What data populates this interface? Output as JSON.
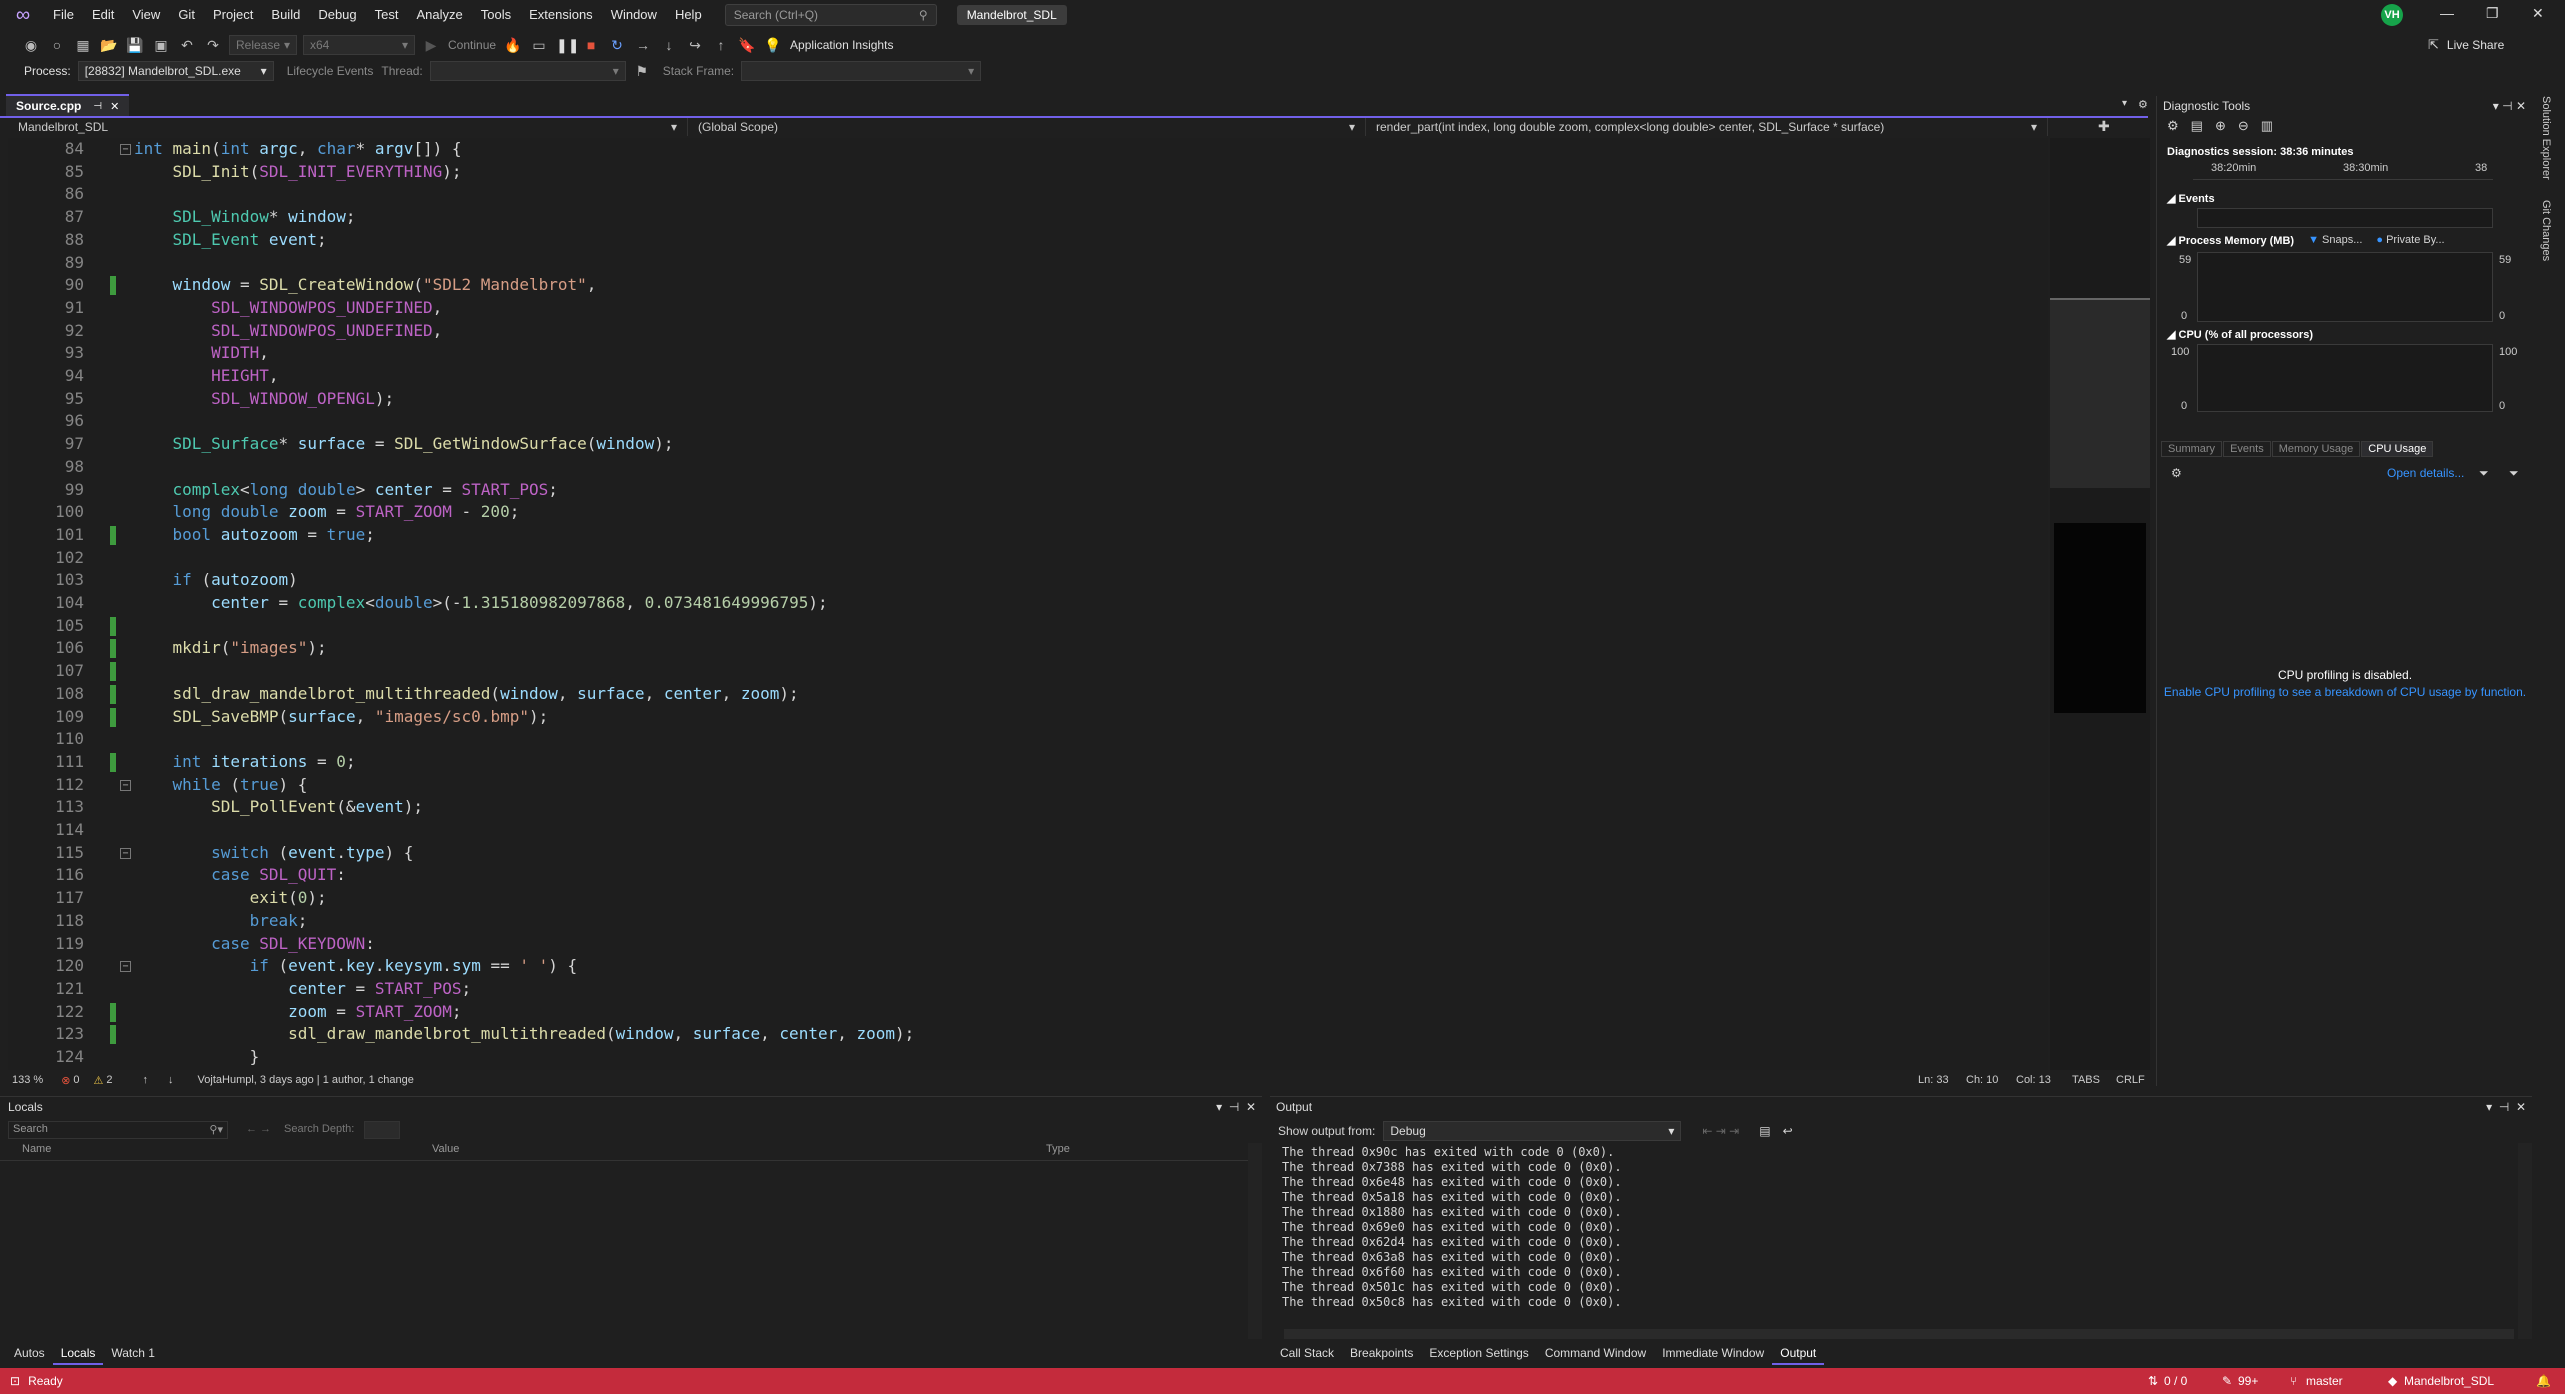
{
  "menu": [
    "File",
    "Edit",
    "View",
    "Git",
    "Project",
    "Build",
    "Debug",
    "Test",
    "Analyze",
    "Tools",
    "Extensions",
    "Window",
    "Help"
  ],
  "search": {
    "placeholder": "Search (Ctrl+Q)"
  },
  "solution_name": "Mandelbrot_SDL",
  "user_initials": "VH",
  "live_share": "Live Share",
  "toolbar": {
    "config": "Release",
    "platform": "x64",
    "continue": "Continue",
    "insights": "Application Insights"
  },
  "toolbar2": {
    "process_label": "Process:",
    "process_value": "[28832] Mandelbrot_SDL.exe",
    "lifecycle": "Lifecycle Events",
    "thread_label": "Thread:",
    "stack_label": "Stack Frame:"
  },
  "doc_tab": {
    "name": "Source.cpp"
  },
  "navbar": {
    "project": "Mandelbrot_SDL",
    "scope": "(Global Scope)",
    "function": "render_part(int index, long double zoom, complex<long double> center, SDL_Surface * surface)"
  },
  "editor_status": {
    "zoom": "133 %",
    "errors": "0",
    "warnings": "2",
    "git_blame": "VojtaHumpl, 3 days ago | 1 author, 1 change",
    "ln": "Ln: 33",
    "ch": "Ch: 10",
    "col": "Col: 13",
    "tabs": "TABS",
    "eol": "CRLF"
  },
  "diagnostics": {
    "title": "Diagnostic Tools",
    "session": "Diagnostics session: 38:36 minutes",
    "tick1": "38:20min",
    "tick2": "38:30min",
    "tick3": "38",
    "events": "Events",
    "memory": "Process Memory (MB)",
    "snaps": "Snaps...",
    "private": "Private By...",
    "mem_max": "59",
    "mem_min": "0",
    "cpu": "CPU (% of all processors)",
    "cpu_max": "100",
    "cpu_min": "0",
    "tabs": [
      "Summary",
      "Events",
      "Memory Usage",
      "CPU Usage"
    ],
    "open_details": "Open details...",
    "cpu_disabled": "CPU profiling is disabled.",
    "cpu_enable": "Enable CPU profiling to see a breakdown of CPU usage by function."
  },
  "side_tabs": [
    "Solution Explorer",
    "Git Changes"
  ],
  "locals": {
    "title": "Locals",
    "search_placeholder": "Search",
    "search_depth": "Search Depth:",
    "cols": [
      "Name",
      "Value",
      "Type"
    ],
    "tabs": [
      "Autos",
      "Locals",
      "Watch 1"
    ]
  },
  "output": {
    "title": "Output",
    "show_from": "Show output from:",
    "source": "Debug",
    "lines": [
      "The thread 0x90c has exited with code 0 (0x0).",
      "The thread 0x7388 has exited with code 0 (0x0).",
      "The thread 0x6e48 has exited with code 0 (0x0).",
      "The thread 0x5a18 has exited with code 0 (0x0).",
      "The thread 0x1880 has exited with code 0 (0x0).",
      "The thread 0x69e0 has exited with code 0 (0x0).",
      "The thread 0x62d4 has exited with code 0 (0x0).",
      "The thread 0x63a8 has exited with code 0 (0x0).",
      "The thread 0x6f60 has exited with code 0 (0x0).",
      "The thread 0x501c has exited with code 0 (0x0).",
      "The thread 0x50c8 has exited with code 0 (0x0)."
    ],
    "tabs": [
      "Call Stack",
      "Breakpoints",
      "Exception Settings",
      "Command Window",
      "Immediate Window",
      "Output"
    ]
  },
  "status": {
    "ready": "Ready",
    "errors": "0 / 0",
    "changes": "99+",
    "branch": "master",
    "project": "Mandelbrot_SDL"
  },
  "code_lines": [
    {
      "n": "84",
      "tokens": [
        [
          "k",
          "int "
        ],
        [
          "f",
          "main"
        ],
        [
          "p",
          "("
        ],
        [
          "k",
          "int "
        ],
        [
          "v",
          "argc"
        ],
        [
          "p",
          ", "
        ],
        [
          "k",
          "char"
        ],
        [
          "p",
          "* "
        ],
        [
          "v",
          "argv"
        ],
        [
          "p",
          "[]) {"
        ]
      ],
      "fold": true
    },
    {
      "n": "85",
      "tokens": [
        [
          "p",
          "    "
        ],
        [
          "f",
          "SDL_Init"
        ],
        [
          "p",
          "("
        ],
        [
          "m",
          "SDL_INIT_EVERYTHING"
        ],
        [
          "p",
          ");"
        ]
      ]
    },
    {
      "n": "86",
      "tokens": []
    },
    {
      "n": "87",
      "tokens": [
        [
          "p",
          "    "
        ],
        [
          "t",
          "SDL_Window"
        ],
        [
          "p",
          "* "
        ],
        [
          "v",
          "window"
        ],
        [
          "p",
          ";"
        ]
      ]
    },
    {
      "n": "88",
      "tokens": [
        [
          "p",
          "    "
        ],
        [
          "t",
          "SDL_Event "
        ],
        [
          "v",
          "event"
        ],
        [
          "p",
          ";"
        ]
      ]
    },
    {
      "n": "89",
      "tokens": []
    },
    {
      "n": "90",
      "tokens": [
        [
          "p",
          "    "
        ],
        [
          "v",
          "window"
        ],
        [
          "p",
          " = "
        ],
        [
          "f",
          "SDL_CreateWindow"
        ],
        [
          "p",
          "("
        ],
        [
          "s",
          "\"SDL2 Mandelbrot\""
        ],
        [
          "p",
          ","
        ]
      ],
      "chg": true
    },
    {
      "n": "91",
      "tokens": [
        [
          "p",
          "        "
        ],
        [
          "m",
          "SDL_WINDOWPOS_UNDEFINED"
        ],
        [
          "p",
          ","
        ]
      ]
    },
    {
      "n": "92",
      "tokens": [
        [
          "p",
          "        "
        ],
        [
          "m",
          "SDL_WINDOWPOS_UNDEFINED"
        ],
        [
          "p",
          ","
        ]
      ]
    },
    {
      "n": "93",
      "tokens": [
        [
          "p",
          "        "
        ],
        [
          "m",
          "WIDTH"
        ],
        [
          "p",
          ","
        ]
      ]
    },
    {
      "n": "94",
      "tokens": [
        [
          "p",
          "        "
        ],
        [
          "m",
          "HEIGHT"
        ],
        [
          "p",
          ","
        ]
      ]
    },
    {
      "n": "95",
      "tokens": [
        [
          "p",
          "        "
        ],
        [
          "m",
          "SDL_WINDOW_OPENGL"
        ],
        [
          "p",
          ");"
        ]
      ]
    },
    {
      "n": "96",
      "tokens": []
    },
    {
      "n": "97",
      "tokens": [
        [
          "p",
          "    "
        ],
        [
          "t",
          "SDL_Surface"
        ],
        [
          "p",
          "* "
        ],
        [
          "v",
          "surface"
        ],
        [
          "p",
          " = "
        ],
        [
          "f",
          "SDL_GetWindowSurface"
        ],
        [
          "p",
          "("
        ],
        [
          "v",
          "window"
        ],
        [
          "p",
          ");"
        ]
      ]
    },
    {
      "n": "98",
      "tokens": []
    },
    {
      "n": "99",
      "tokens": [
        [
          "p",
          "    "
        ],
        [
          "t",
          "complex"
        ],
        [
          "p",
          "<"
        ],
        [
          "k",
          "long double"
        ],
        [
          "p",
          "> "
        ],
        [
          "v",
          "center"
        ],
        [
          "p",
          " = "
        ],
        [
          "m",
          "START_POS"
        ],
        [
          "p",
          ";"
        ]
      ]
    },
    {
      "n": "100",
      "tokens": [
        [
          "p",
          "    "
        ],
        [
          "k",
          "long double "
        ],
        [
          "v",
          "zoom"
        ],
        [
          "p",
          " = "
        ],
        [
          "m",
          "START_ZOOM"
        ],
        [
          "p",
          " - "
        ],
        [
          "n",
          "200"
        ],
        [
          "p",
          ";"
        ]
      ]
    },
    {
      "n": "101",
      "tokens": [
        [
          "p",
          "    "
        ],
        [
          "k",
          "bool "
        ],
        [
          "v",
          "autozoom"
        ],
        [
          "p",
          " = "
        ],
        [
          "k",
          "true"
        ],
        [
          "p",
          ";"
        ]
      ],
      "chg": true
    },
    {
      "n": "102",
      "tokens": []
    },
    {
      "n": "103",
      "tokens": [
        [
          "p",
          "    "
        ],
        [
          "k",
          "if "
        ],
        [
          "p",
          "("
        ],
        [
          "v",
          "autozoom"
        ],
        [
          "p",
          ")"
        ]
      ]
    },
    {
      "n": "104",
      "tokens": [
        [
          "p",
          "        "
        ],
        [
          "v",
          "center"
        ],
        [
          "p",
          " = "
        ],
        [
          "t",
          "complex"
        ],
        [
          "p",
          "<"
        ],
        [
          "k",
          "double"
        ],
        [
          "p",
          ">(-"
        ],
        [
          "n",
          "1.315180982097868"
        ],
        [
          "p",
          ", "
        ],
        [
          "n",
          "0.073481649996795"
        ],
        [
          "p",
          ");"
        ]
      ]
    },
    {
      "n": "105",
      "tokens": [],
      "chg": true
    },
    {
      "n": "106",
      "tokens": [
        [
          "p",
          "    "
        ],
        [
          "f",
          "mkdir"
        ],
        [
          "p",
          "("
        ],
        [
          "s",
          "\"images\""
        ],
        [
          "p",
          ");"
        ]
      ],
      "chg": true
    },
    {
      "n": "107",
      "tokens": [],
      "chg": true
    },
    {
      "n": "108",
      "tokens": [
        [
          "p",
          "    "
        ],
        [
          "f",
          "sdl_draw_mandelbrot_multithreaded"
        ],
        [
          "p",
          "("
        ],
        [
          "v",
          "window"
        ],
        [
          "p",
          ", "
        ],
        [
          "v",
          "surface"
        ],
        [
          "p",
          ", "
        ],
        [
          "v",
          "center"
        ],
        [
          "p",
          ", "
        ],
        [
          "v",
          "zoom"
        ],
        [
          "p",
          ");"
        ]
      ],
      "chg": true
    },
    {
      "n": "109",
      "tokens": [
        [
          "p",
          "    "
        ],
        [
          "f",
          "SDL_SaveBMP"
        ],
        [
          "p",
          "("
        ],
        [
          "v",
          "surface"
        ],
        [
          "p",
          ", "
        ],
        [
          "s",
          "\"images/sc0.bmp\""
        ],
        [
          "p",
          ");"
        ]
      ],
      "chg": true
    },
    {
      "n": "110",
      "tokens": []
    },
    {
      "n": "111",
      "tokens": [
        [
          "p",
          "    "
        ],
        [
          "k",
          "int "
        ],
        [
          "v",
          "iterations"
        ],
        [
          "p",
          " = "
        ],
        [
          "n",
          "0"
        ],
        [
          "p",
          ";"
        ]
      ],
      "chg": true
    },
    {
      "n": "112",
      "tokens": [
        [
          "p",
          "    "
        ],
        [
          "k",
          "while "
        ],
        [
          "p",
          "("
        ],
        [
          "k",
          "true"
        ],
        [
          "p",
          ") {"
        ]
      ],
      "fold": true
    },
    {
      "n": "113",
      "tokens": [
        [
          "p",
          "        "
        ],
        [
          "f",
          "SDL_PollEvent"
        ],
        [
          "p",
          "(&"
        ],
        [
          "v",
          "event"
        ],
        [
          "p",
          ");"
        ]
      ]
    },
    {
      "n": "114",
      "tokens": []
    },
    {
      "n": "115",
      "tokens": [
        [
          "p",
          "        "
        ],
        [
          "k",
          "switch "
        ],
        [
          "p",
          "("
        ],
        [
          "v",
          "event"
        ],
        [
          "p",
          "."
        ],
        [
          "v",
          "type"
        ],
        [
          "p",
          ") {"
        ]
      ],
      "fold": true
    },
    {
      "n": "116",
      "tokens": [
        [
          "p",
          "        "
        ],
        [
          "k",
          "case "
        ],
        [
          "m",
          "SDL_QUIT"
        ],
        [
          "p",
          ":"
        ]
      ]
    },
    {
      "n": "117",
      "tokens": [
        [
          "p",
          "            "
        ],
        [
          "f",
          "exit"
        ],
        [
          "p",
          "("
        ],
        [
          "n",
          "0"
        ],
        [
          "p",
          ");"
        ]
      ]
    },
    {
      "n": "118",
      "tokens": [
        [
          "p",
          "            "
        ],
        [
          "k",
          "break"
        ],
        [
          "p",
          ";"
        ]
      ]
    },
    {
      "n": "119",
      "tokens": [
        [
          "p",
          "        "
        ],
        [
          "k",
          "case "
        ],
        [
          "m",
          "SDL_KEYDOWN"
        ],
        [
          "p",
          ":"
        ]
      ]
    },
    {
      "n": "120",
      "tokens": [
        [
          "p",
          "            "
        ],
        [
          "k",
          "if "
        ],
        [
          "p",
          "("
        ],
        [
          "v",
          "event"
        ],
        [
          "p",
          "."
        ],
        [
          "v",
          "key"
        ],
        [
          "p",
          "."
        ],
        [
          "v",
          "keysym"
        ],
        [
          "p",
          "."
        ],
        [
          "v",
          "sym"
        ],
        [
          "p",
          " == "
        ],
        [
          "s",
          "' '"
        ],
        [
          "p",
          ") {"
        ]
      ],
      "fold": true
    },
    {
      "n": "121",
      "tokens": [
        [
          "p",
          "                "
        ],
        [
          "v",
          "center"
        ],
        [
          "p",
          " = "
        ],
        [
          "m",
          "START_POS"
        ],
        [
          "p",
          ";"
        ]
      ]
    },
    {
      "n": "122",
      "tokens": [
        [
          "p",
          "                "
        ],
        [
          "v",
          "zoom"
        ],
        [
          "p",
          " = "
        ],
        [
          "m",
          "START_ZOOM"
        ],
        [
          "p",
          ";"
        ]
      ],
      "chg": true
    },
    {
      "n": "123",
      "tokens": [
        [
          "p",
          "                "
        ],
        [
          "f",
          "sdl_draw_mandelbrot_multithreaded"
        ],
        [
          "p",
          "("
        ],
        [
          "v",
          "window"
        ],
        [
          "p",
          ", "
        ],
        [
          "v",
          "surface"
        ],
        [
          "p",
          ", "
        ],
        [
          "v",
          "center"
        ],
        [
          "p",
          ", "
        ],
        [
          "v",
          "zoom"
        ],
        [
          "p",
          ");"
        ]
      ],
      "chg": true
    },
    {
      "n": "124",
      "tokens": [
        [
          "p",
          "            }"
        ]
      ]
    }
  ]
}
